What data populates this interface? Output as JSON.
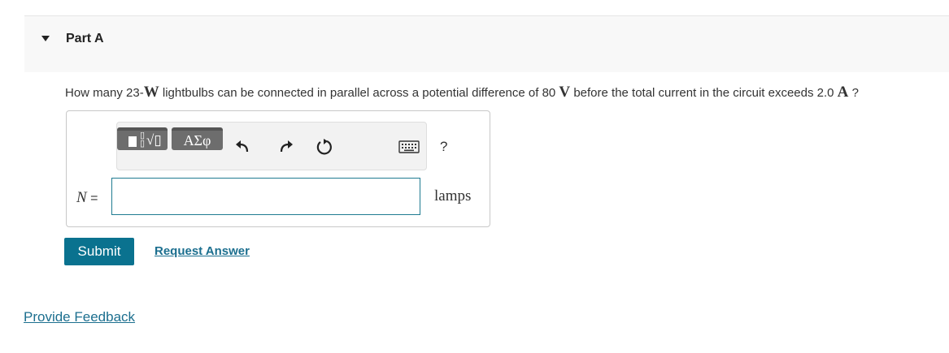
{
  "part": {
    "title": "Part A"
  },
  "question": {
    "seg1": "How many 23-",
    "unit_w": "W",
    "seg2": " lightbulbs can be connected in parallel across a potential difference of 80 ",
    "unit_v": "V",
    "seg3": " before the total current in the circuit exceeds 2.0 ",
    "unit_a": "A",
    "seg4": " ?"
  },
  "answer": {
    "variable": "N",
    "equals": " =",
    "input_value": "",
    "unit": "lamps"
  },
  "toolbar": {
    "templates_icon": "math-templates-icon",
    "greek_label": "ΑΣφ",
    "undo_icon": "undo-icon",
    "redo_icon": "redo-icon",
    "reset_icon": "reset-icon",
    "keyboard_icon": "keyboard-icon",
    "help_label": "?"
  },
  "actions": {
    "submit_label": "Submit",
    "request_answer_label": "Request Answer"
  },
  "footer": {
    "feedback_label": "Provide Feedback"
  },
  "colors": {
    "accent": "#0a728f",
    "link": "#1c6f8f",
    "toolbar_button": "#6d6d6d"
  }
}
